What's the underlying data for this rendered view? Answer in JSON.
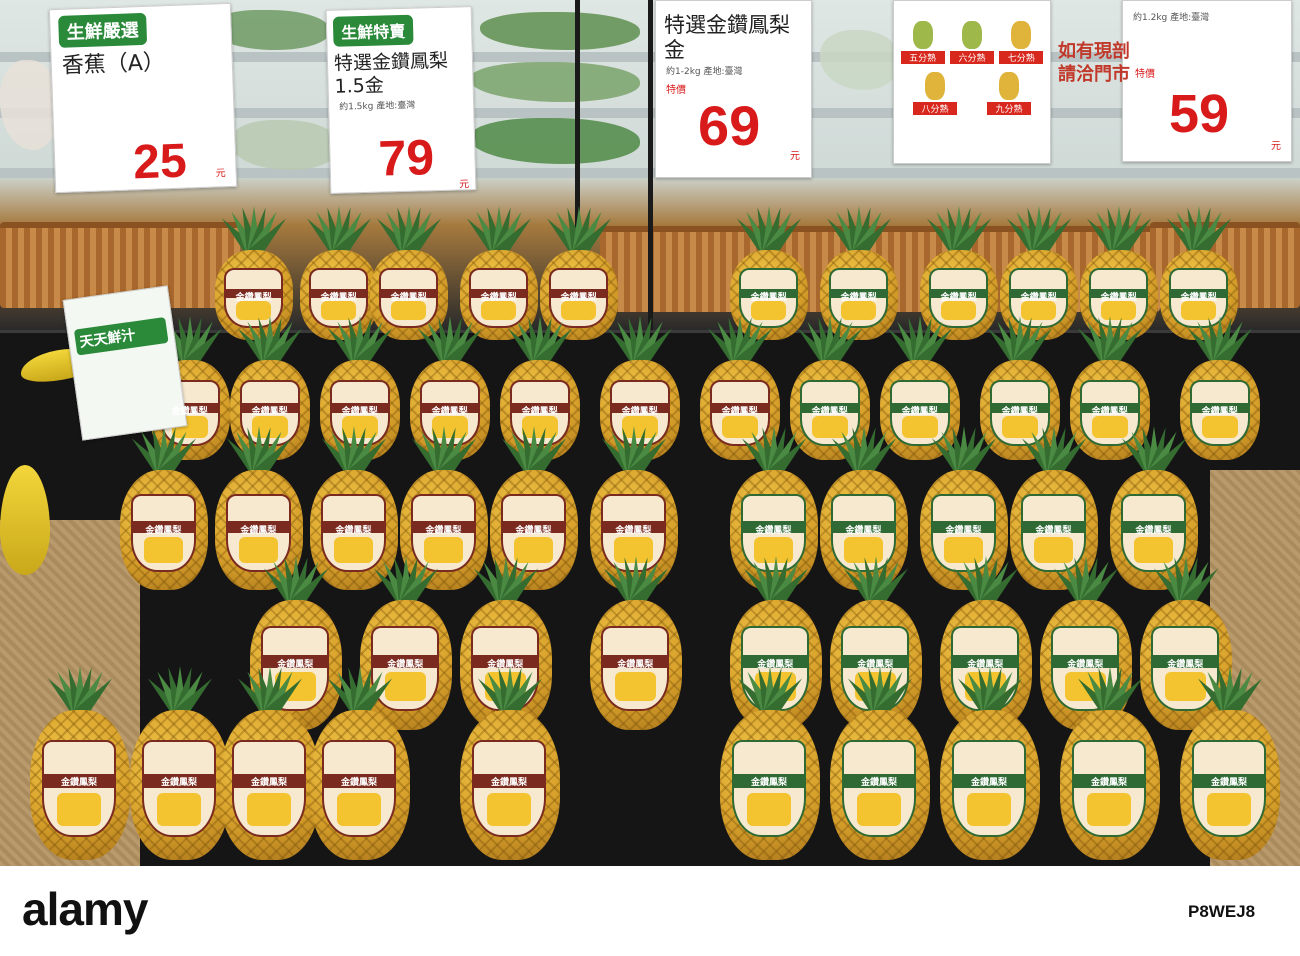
{
  "photo": {
    "description_alt": "Supermarket display of golden diamond pineapples with price signs"
  },
  "signs": [
    {
      "badge": "生鮮嚴選",
      "name": "香蕉（A）",
      "price": "25",
      "unit": "元"
    },
    {
      "badge": "生鮮特賣",
      "name": "特選金鑽鳳梨1.5金",
      "detail": "約1.5kg 產地:臺灣",
      "price": "79",
      "unit": "元"
    },
    {
      "badge": "",
      "name": "特選金鑽鳳梨金",
      "detail": "約1-2kg 產地:臺灣",
      "price_label": "特價",
      "price": "69",
      "unit": "元"
    },
    {
      "badge": "",
      "name": "如有現剖 請洽門市",
      "detail": "約1.2kg 產地:臺灣",
      "price_label": "特價",
      "price": "59",
      "unit": "元"
    }
  ],
  "ripeness_card": {
    "levels": [
      "五分熟",
      "六分熟",
      "七分熟",
      "八分熟",
      "九分熟"
    ]
  },
  "product_label": "金鑽鳳梨",
  "juice_sign": "天天鮮汁",
  "watermark": {
    "brand": "alamy",
    "id": "P8WEJ8",
    "stock_text": "",
    "url": ""
  }
}
